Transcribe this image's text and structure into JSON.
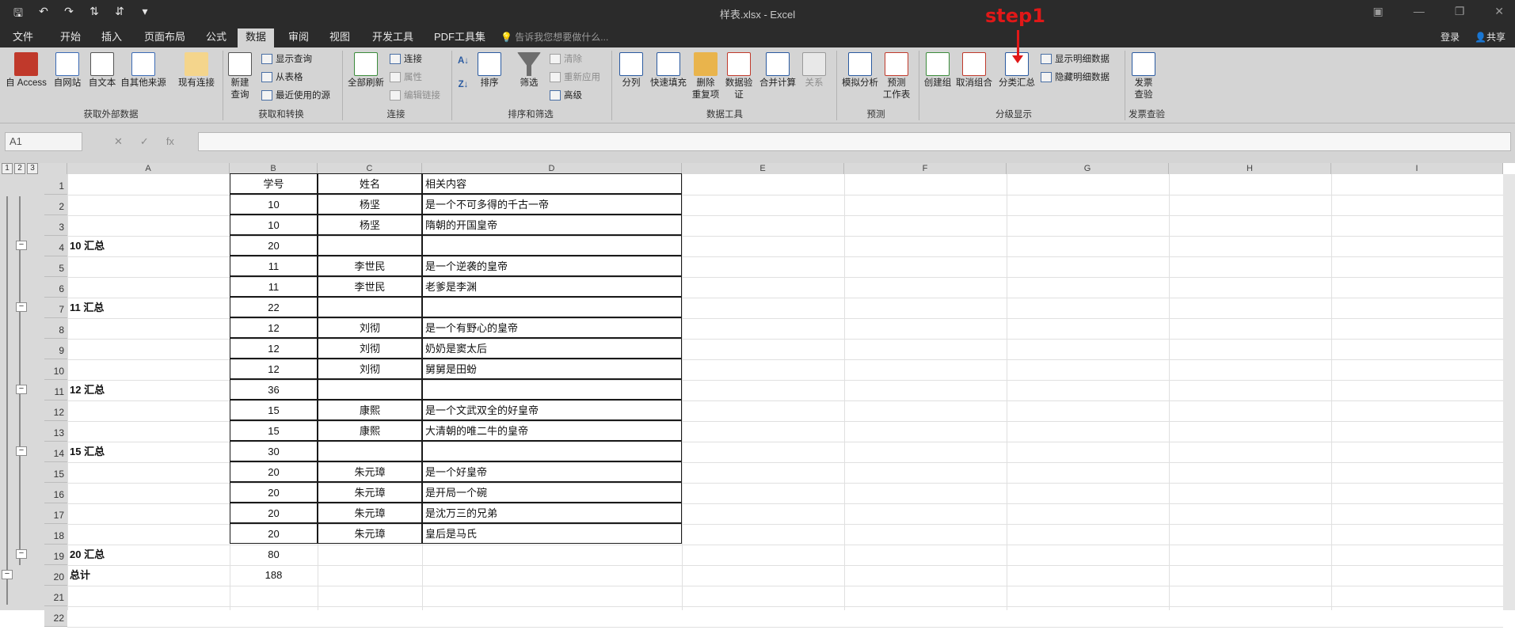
{
  "window": {
    "title": "样表.xlsx - Excel",
    "login": "登录",
    "share": "共享",
    "tell_me": "告诉我您想要做什么..."
  },
  "tabs": [
    "文件",
    "开始",
    "插入",
    "页面布局",
    "公式",
    "数据",
    "审阅",
    "视图",
    "开发工具",
    "PDF工具集"
  ],
  "active_tab": "数据",
  "annotation": "step1",
  "ribbon": {
    "get_external": {
      "label": "获取外部数据",
      "buttons": [
        "自 Access",
        "自网站",
        "自文本",
        "自其他来源",
        "现有连接"
      ]
    },
    "get_transform": {
      "label": "获取和转换",
      "main": "新建\n查询",
      "small": [
        "显示查询",
        "从表格",
        "最近使用的源"
      ]
    },
    "connections": {
      "label": "连接",
      "main": "全部刷新",
      "small": [
        "连接",
        "属性",
        "编辑链接"
      ]
    },
    "sort_filter": {
      "label": "排序和筛选",
      "sort": "排序",
      "filter": "筛选",
      "small": [
        "清除",
        "重新应用",
        "高级"
      ]
    },
    "data_tools": {
      "label": "数据工具",
      "buttons": [
        "分列",
        "快速填充",
        "删除\n重复项",
        "数据验\n证",
        "合并计算",
        "关系"
      ]
    },
    "forecast": {
      "label": "预测",
      "buttons": [
        "模拟分析",
        "预测\n工作表"
      ]
    },
    "outline": {
      "label": "分级显示",
      "buttons": [
        "创建组",
        "取消组合",
        "分类汇总"
      ],
      "small": [
        "显示明细数据",
        "隐藏明细数据"
      ]
    },
    "invoice": {
      "label": "发票查验",
      "buttons": [
        "发票\n查验"
      ]
    }
  },
  "name_box": "A1",
  "levels": [
    "1",
    "2",
    "3"
  ],
  "columns": [
    "A",
    "B",
    "C",
    "D",
    "E",
    "F",
    "G",
    "H",
    "I"
  ],
  "rows": [
    {
      "n": "1",
      "a": "",
      "b": "学号",
      "c": "姓名",
      "d": "相关内容"
    },
    {
      "n": "2",
      "a": "",
      "b": "10",
      "c": "杨坚",
      "d": "是一个不可多得的千古一帝"
    },
    {
      "n": "3",
      "a": "",
      "b": "10",
      "c": "杨坚",
      "d": "隋朝的开国皇帝"
    },
    {
      "n": "4",
      "a": "10 汇总",
      "b": "20",
      "c": "",
      "d": ""
    },
    {
      "n": "5",
      "a": "",
      "b": "11",
      "c": "李世民",
      "d": "是一个逆袭的皇帝"
    },
    {
      "n": "6",
      "a": "",
      "b": "11",
      "c": "李世民",
      "d": "老爹是李渊"
    },
    {
      "n": "7",
      "a": "11 汇总",
      "b": "22",
      "c": "",
      "d": ""
    },
    {
      "n": "8",
      "a": "",
      "b": "12",
      "c": "刘彻",
      "d": "是一个有野心的皇帝"
    },
    {
      "n": "9",
      "a": "",
      "b": "12",
      "c": "刘彻",
      "d": "奶奶是窦太后"
    },
    {
      "n": "10",
      "a": "",
      "b": "12",
      "c": "刘彻",
      "d": "舅舅是田蚡"
    },
    {
      "n": "11",
      "a": "12 汇总",
      "b": "36",
      "c": "",
      "d": ""
    },
    {
      "n": "12",
      "a": "",
      "b": "15",
      "c": "康熙",
      "d": "是一个文武双全的好皇帝"
    },
    {
      "n": "13",
      "a": "",
      "b": "15",
      "c": "康熙",
      "d": "大清朝的唯二牛的皇帝"
    },
    {
      "n": "14",
      "a": "15 汇总",
      "b": "30",
      "c": "",
      "d": ""
    },
    {
      "n": "15",
      "a": "",
      "b": "20",
      "c": "朱元璋",
      "d": "是一个好皇帝"
    },
    {
      "n": "16",
      "a": "",
      "b": "20",
      "c": "朱元璋",
      "d": "是开局一个碗"
    },
    {
      "n": "17",
      "a": "",
      "b": "20",
      "c": "朱元璋",
      "d": "是沈万三的兄弟"
    },
    {
      "n": "18",
      "a": "",
      "b": "20",
      "c": "朱元璋",
      "d": "皇后是马氏"
    },
    {
      "n": "19",
      "a": "20 汇总",
      "b": "80",
      "c": "",
      "d": ""
    },
    {
      "n": "20",
      "a": "总计",
      "b": "188",
      "c": "",
      "d": ""
    },
    {
      "n": "21",
      "a": "",
      "b": "",
      "c": "",
      "d": ""
    },
    {
      "n": "22",
      "a": "",
      "b": "",
      "c": "",
      "d": ""
    }
  ]
}
